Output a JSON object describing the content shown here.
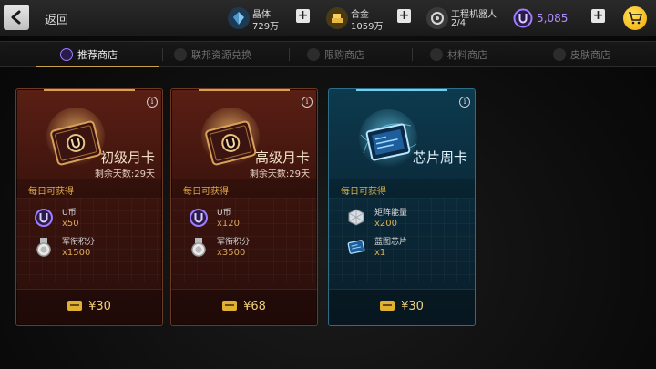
{
  "header": {
    "back_label": "返回",
    "resources": [
      {
        "name": "晶体",
        "value": "729万",
        "color": "#6fb8e8",
        "icon": "crystal-icon"
      },
      {
        "name": "合金",
        "value": "1059万",
        "color": "#e0b040",
        "icon": "alloy-icon"
      },
      {
        "name": "工程机器人",
        "value": "2/4",
        "color": "#cfcfcf",
        "icon": "robot-icon"
      }
    ],
    "credits": {
      "value": "5,085",
      "icon": "u-credit-icon",
      "color": "#b18cff"
    },
    "cart_icon": "cart-icon"
  },
  "tabs": [
    {
      "label": "推荐商店",
      "active": true,
      "icon": "u-credit-icon"
    },
    {
      "label": "联邦资源兑换",
      "active": false,
      "icon": "resource-exchange-icon"
    },
    {
      "label": "限购商店",
      "active": false,
      "icon": "limited-shop-icon"
    },
    {
      "label": "材料商店",
      "active": false,
      "icon": "material-shop-icon"
    },
    {
      "label": "皮肤商店",
      "active": false,
      "icon": "skin-shop-icon"
    }
  ],
  "cards": [
    {
      "title": "初级月卡",
      "subtitle": "剩余天数:29天",
      "daily_label": "每日可获得",
      "items": [
        {
          "name": "U币",
          "qty": "x50",
          "icon": "u-coin-icon"
        },
        {
          "name": "军衔积分",
          "qty": "x1500",
          "icon": "rank-medal-icon"
        }
      ],
      "price": "¥30",
      "theme": "red"
    },
    {
      "title": "高级月卡",
      "subtitle": "剩余天数:29天",
      "daily_label": "每日可获得",
      "items": [
        {
          "name": "U币",
          "qty": "x120",
          "icon": "u-coin-icon"
        },
        {
          "name": "军衔积分",
          "qty": "x3500",
          "icon": "rank-medal-icon"
        }
      ],
      "price": "¥68",
      "theme": "red"
    },
    {
      "title": "芯片周卡",
      "subtitle": "",
      "daily_label": "每日可获得",
      "items": [
        {
          "name": "矩阵能量",
          "qty": "x200",
          "icon": "matrix-energy-icon"
        },
        {
          "name": "蓝图芯片",
          "qty": "x1",
          "icon": "blueprint-chip-icon"
        }
      ],
      "price": "¥30",
      "theme": "blue"
    }
  ]
}
